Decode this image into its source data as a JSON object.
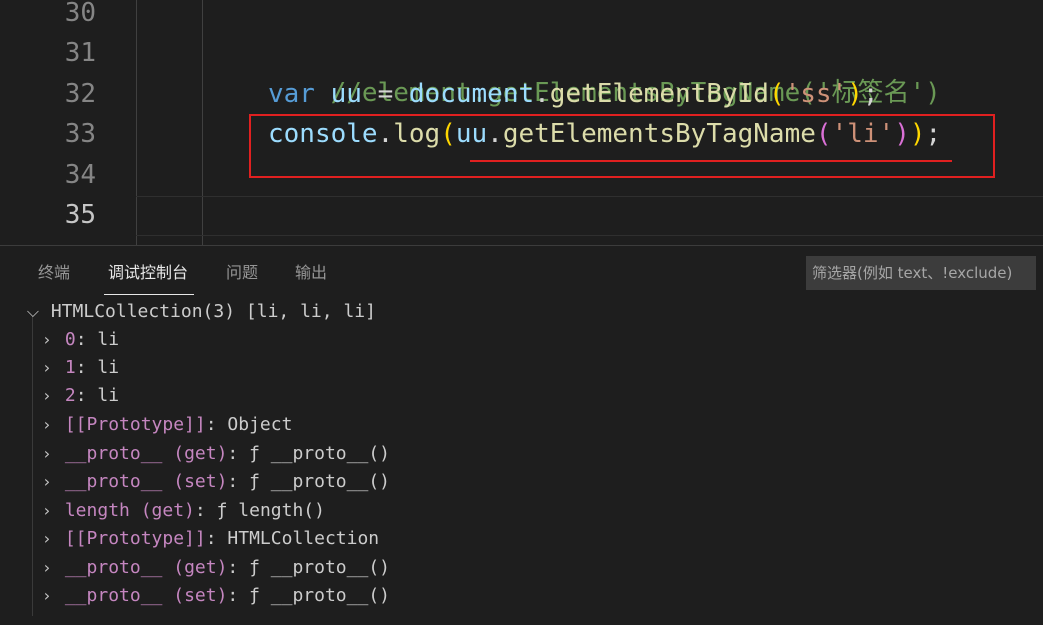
{
  "editor": {
    "line_numbers": [
      "30",
      "31",
      "32",
      "33",
      "34",
      "35"
    ],
    "line31": {
      "comment": "//element.getElementsByTagName('标签名')"
    },
    "line32": {
      "kw": "var",
      "sp1": " ",
      "ident": "uu",
      "eq": " = ",
      "obj": "document",
      "dot": ".",
      "fn": "getElementById",
      "open": "(",
      "str": "'ss'",
      "close": ")",
      "semi": ";"
    },
    "line33": {
      "obj": "console",
      "dot1": ".",
      "fn1": "log",
      "open1": "(",
      "ident": "uu",
      "dot2": ".",
      "fn2": "getElementsByTagName",
      "open2": "(",
      "str": "'li'",
      "close2": ")",
      "close1": ")",
      "semi": ";"
    }
  },
  "panel": {
    "tabs": [
      "终端",
      "调试控制台",
      "问题",
      "输出"
    ],
    "active_tab": "调试控制台",
    "filter_placeholder": "筛选器(例如 text、!exclude)"
  },
  "console": {
    "root": "HTMLCollection(3) [li, li, li]",
    "items": [
      {
        "key": "0",
        "sep": ": ",
        "value": "li"
      },
      {
        "key": "1",
        "sep": ": ",
        "value": "li"
      },
      {
        "key": "2",
        "sep": ": ",
        "value": "li"
      },
      {
        "key": "[[Prototype]]",
        "sep": ": ",
        "value": "Object"
      },
      {
        "key": "__proto__",
        "mid": " (get)",
        "sep": ": ",
        "value": "ƒ __proto__()"
      },
      {
        "key": "__proto__",
        "mid": " (set)",
        "sep": ": ",
        "value": "ƒ __proto__()"
      },
      {
        "key": "length",
        "mid": " (get)",
        "sep": ": ",
        "value": "ƒ length()"
      },
      {
        "key": "[[Prototype]]",
        "sep": ": ",
        "value": "HTMLCollection"
      },
      {
        "key": "__proto__",
        "mid": " (get)",
        "sep": ": ",
        "value": "ƒ __proto__()"
      },
      {
        "key": "__proto__",
        "mid": " (set)",
        "sep": ": ",
        "value": "ƒ __proto__()"
      }
    ]
  },
  "icons": {
    "expanded": "chevron-down-icon",
    "collapsed": "chevron-right-icon"
  },
  "colors": {
    "background": "#1e1e1e",
    "highlight_box": "#e02020",
    "comment": "#6a9955",
    "keyword": "#569cd6",
    "variable": "#9cdcfe",
    "function": "#dcdcaa",
    "string": "#ce9178",
    "property": "#c586c0"
  }
}
